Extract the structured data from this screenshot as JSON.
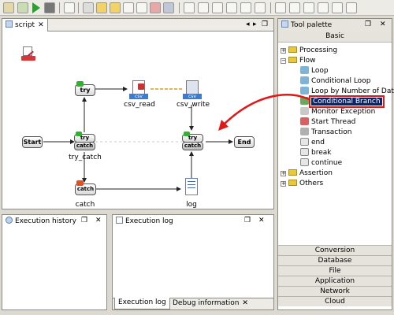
{
  "script_tab": {
    "label": "script"
  },
  "diagram": {
    "nodes": {
      "start": "Start",
      "end": "End",
      "try_box": "try",
      "catch_box": "catch",
      "try_catch_top": "try",
      "try_catch_bottom": "catch",
      "merge_top": "try",
      "merge_bottom": "catch",
      "csv_read_tag": "csv",
      "csv_write_tag": "csv"
    },
    "labels": {
      "csv_read": "csv_read",
      "csv_write": "csv_write",
      "try_catch": "try_catch",
      "catch": "catch",
      "log": "log"
    }
  },
  "tool_palette": {
    "title": "Tool palette",
    "top_category": "Basic",
    "tree": [
      {
        "label": "Processing"
      },
      {
        "label": "Flow"
      },
      {
        "label": "Loop"
      },
      {
        "label": "Conditional Loop"
      },
      {
        "label": "Loop by Number of Data"
      },
      {
        "label": "Conditional Branch"
      },
      {
        "label": "Monitor Exception"
      },
      {
        "label": "Start Thread"
      },
      {
        "label": "Transaction"
      },
      {
        "label": "end"
      },
      {
        "label": "break"
      },
      {
        "label": "continue"
      },
      {
        "label": "Assertion"
      },
      {
        "label": "Others"
      }
    ],
    "categories": [
      "Conversion",
      "Database",
      "File",
      "Application",
      "Network",
      "Cloud"
    ]
  },
  "execution_history": {
    "title": "Execution history"
  },
  "execution_log": {
    "title": "Execution log"
  },
  "bottom_tabs": {
    "execution_log": "Execution log",
    "debug_information": "Debug information"
  },
  "colors": {
    "highlight": "#0a246a",
    "annotation_red": "#e21818",
    "accent_green": "#3bb33b"
  }
}
